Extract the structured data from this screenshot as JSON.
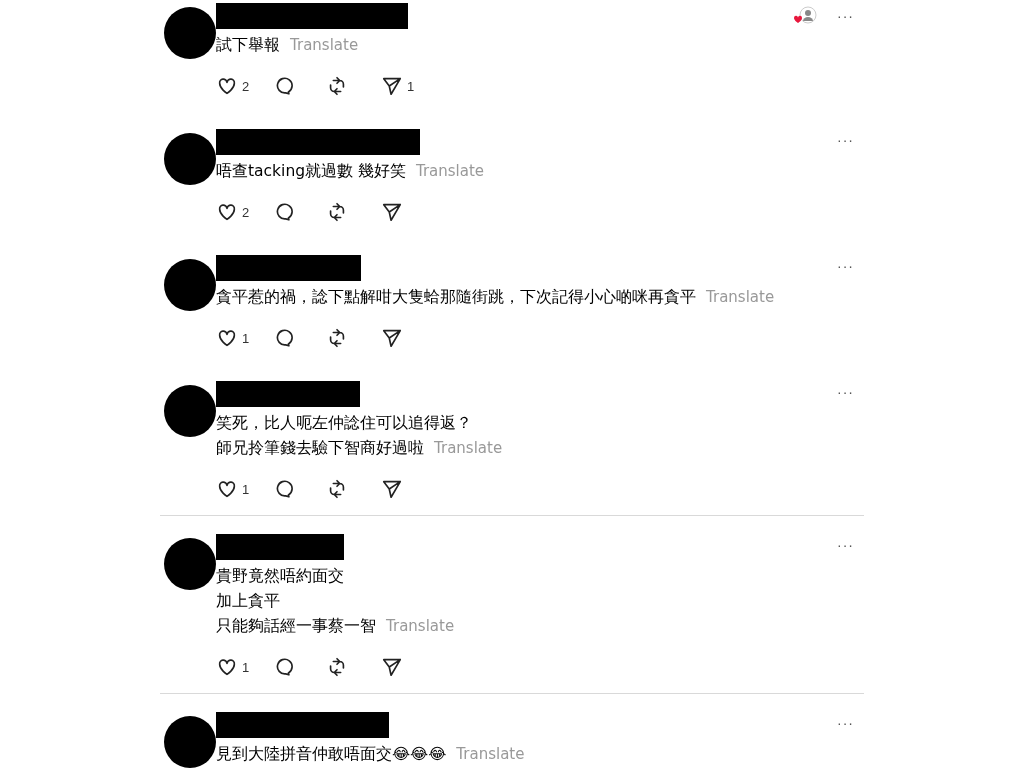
{
  "posts": [
    {
      "text_lines": [
        "試下舉報"
      ],
      "translate": "Translate",
      "menu": "···",
      "liked_by_author": true,
      "actions": {
        "likes": "2",
        "shares": "1"
      },
      "divider_below": false
    },
    {
      "text_lines": [
        "唔查tacking就過數 幾好笑"
      ],
      "translate": "Translate",
      "menu": "···",
      "liked_by_author": false,
      "actions": {
        "likes": "2"
      },
      "divider_below": false
    },
    {
      "text_lines": [
        "貪平惹的禍，諗下點解咁大隻蛤那隨街跳，下次記得小心啲咪再貪平"
      ],
      "translate": "Translate",
      "menu": "···",
      "liked_by_author": false,
      "actions": {
        "likes": "1"
      },
      "divider_below": false
    },
    {
      "text_lines": [
        "笑死，比人呃左仲諗住可以追得返？",
        "師兄拎筆錢去驗下智商好過啦"
      ],
      "translate": "Translate",
      "menu": "···",
      "liked_by_author": false,
      "actions": {
        "likes": "1"
      },
      "divider_below": true
    },
    {
      "text_lines": [
        "貴野竟然唔約面交",
        "加上貪平",
        "只能夠話經一事蔡一智"
      ],
      "translate": "Translate",
      "menu": "···",
      "liked_by_author": false,
      "actions": {
        "likes": "1"
      },
      "divider_below": true
    },
    {
      "text_lines": [
        "見到大陸拼音仲敢唔面交😂😂😂"
      ],
      "translate": "Translate",
      "menu": "···",
      "liked_by_author": false,
      "divider_below": false
    }
  ]
}
